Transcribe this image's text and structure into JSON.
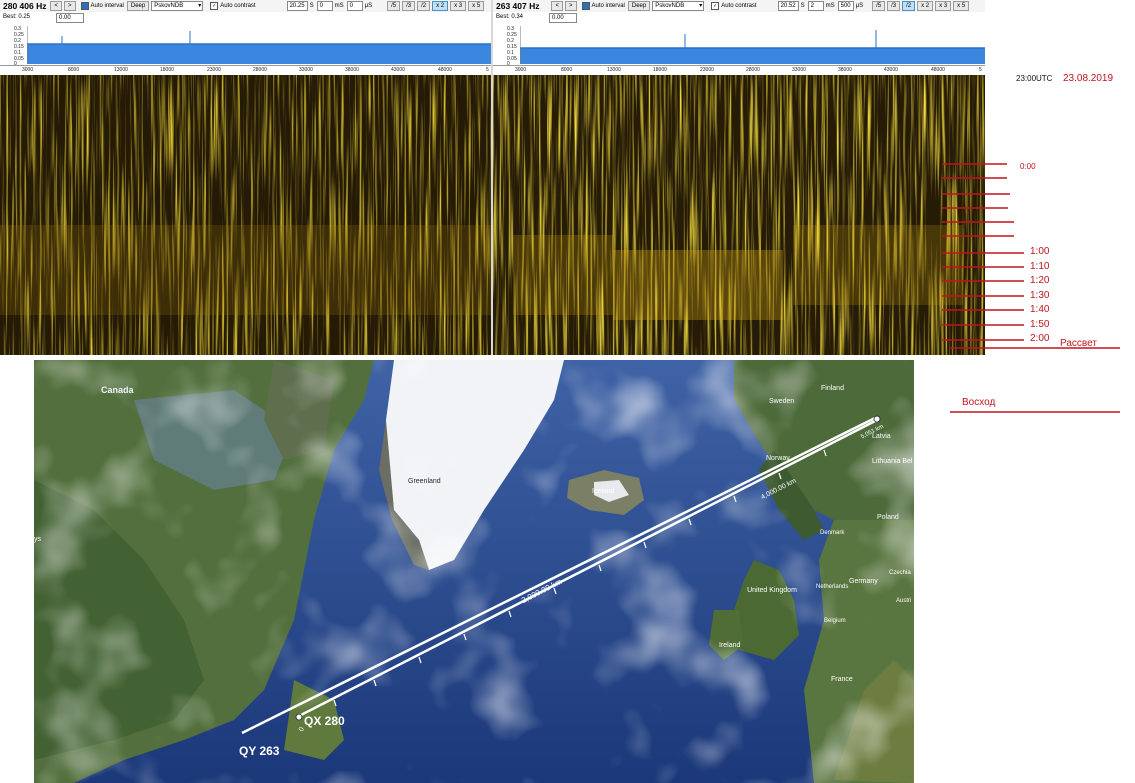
{
  "panels": [
    {
      "frequency": "280 406 Hz",
      "auto_interval": "Auto interval",
      "deep": "Deep",
      "profile": "PskovNDB",
      "auto_contrast": "Auto contrast",
      "fields": [
        "20.25",
        "S",
        "0",
        "mS",
        "0",
        "µS"
      ],
      "zoom_buttons": [
        "/5",
        "/3",
        "/2",
        "x 2",
        "x 3",
        "x 5"
      ],
      "zoom_active": "x 2",
      "best_label": "Best: 0.25",
      "best_value": "0.00",
      "db_ticks": [
        "0.3",
        "0.25",
        "0.2",
        "0.15",
        "0.1",
        "0.05",
        "0"
      ],
      "freq_ticks": [
        "3000",
        "8000",
        "13000",
        "18000",
        "23000",
        "28000",
        "33000",
        "38000",
        "43000",
        "48000",
        "5"
      ]
    },
    {
      "frequency": "263 407 Hz",
      "auto_interval": "Auto interval",
      "deep": "Deep",
      "profile": "PskovNDB",
      "auto_contrast": "Auto contrast",
      "fields": [
        "20.52",
        "S",
        "2",
        "mS",
        "500",
        "µS"
      ],
      "zoom_buttons": [
        "/5",
        "/3",
        "/2",
        "x 2",
        "x 3",
        "x 5"
      ],
      "zoom_active": "/2",
      "best_label": "Best: 0.34",
      "best_value": "0.00",
      "db_ticks": [
        "0.3",
        "0.25",
        "0.2",
        "0.15",
        "0.1",
        "0.05",
        "0"
      ],
      "freq_ticks": [
        "3000",
        "8000",
        "13000",
        "18000",
        "23000",
        "28000",
        "33000",
        "38000",
        "43000",
        "48000",
        "5"
      ]
    }
  ],
  "annotations": {
    "utc_time": "23:00UTC",
    "date": "23.08.2019",
    "time_marks": [
      "0:00",
      "1:00",
      "1:10",
      "1:20",
      "1:30",
      "1:40",
      "1:50",
      "2:00"
    ],
    "dawn": "Рассвет",
    "sunrise": "Восход",
    "color_red": "#c0141b"
  },
  "map": {
    "place_labels": [
      "Canada",
      "Greenland",
      "Iceland",
      "Finland",
      "Sweden",
      "Norway",
      "Latvia",
      "Lithuania Bel",
      "Poland",
      "Denmark",
      "Netherlands",
      "Germany",
      "Czechia",
      "Austri",
      "Belgium",
      "United Kingdom",
      "Ireland",
      "France",
      "ys"
    ],
    "distance_labels": [
      "2,000.00 km",
      "4,000.00 km",
      "5,051 km",
      "0"
    ],
    "stations": [
      "QX 280",
      "QY 263"
    ]
  }
}
